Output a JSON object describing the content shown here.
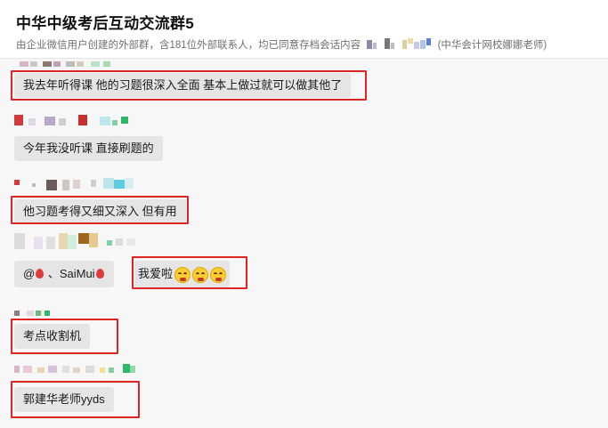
{
  "header": {
    "title": "中华中级考后互动交流群5",
    "subtitle_prefix": "由企业微信用户创建的外部群，含181位外部联系人，均已同意存档会话内容",
    "subtitle_suffix": "(中华会计网校娜娜老师)"
  },
  "messages": [
    {
      "text": "我去年听得课 他的习题很深入全面 基本上做过就可以做其他了",
      "highlighted": true
    },
    {
      "text": "今年我没听课 直接刷题的",
      "highlighted": false
    },
    {
      "text": "他习题考得又细又深入 但有用",
      "highlighted": true
    },
    {
      "mention_at": "@",
      "mention_name": "、SaiMui",
      "reply_text": "我爱啦",
      "highlighted": true
    },
    {
      "text": "考点收割机",
      "highlighted": true
    },
    {
      "text": "郭建华老师yyds",
      "highlighted": true
    }
  ],
  "colors": {
    "highlight": "#e02424",
    "bubble": "#e5e5e5",
    "chat_bg": "#f7f7f7"
  }
}
